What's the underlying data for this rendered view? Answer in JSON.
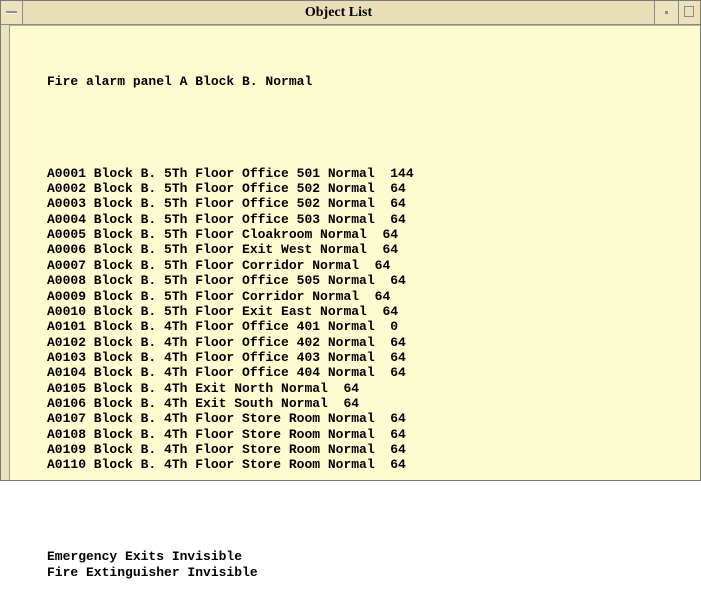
{
  "window": {
    "title": "Object List"
  },
  "content": {
    "header_line": "Fire alarm panel A Block B. Normal",
    "objects": [
      "A0001 Block B. 5Th Floor Office 501 Normal  144",
      "A0002 Block B. 5Th Floor Office 502 Normal  64",
      "A0003 Block B. 5Th Floor Office 502 Normal  64",
      "A0004 Block B. 5Th Floor Office 503 Normal  64",
      "A0005 Block B. 5Th Floor Cloakroom Normal  64",
      "A0006 Block B. 5Th Floor Exit West Normal  64",
      "A0007 Block B. 5Th Floor Corridor Normal  64",
      "A0008 Block B. 5Th Floor Office 505 Normal  64",
      "A0009 Block B. 5Th Floor Corridor Normal  64",
      "A0010 Block B. 5Th Floor Exit East Normal  64",
      "A0101 Block B. 4Th Floor Office 401 Normal  0",
      "A0102 Block B. 4Th Floor Office 402 Normal  64",
      "A0103 Block B. 4Th Floor Office 403 Normal  64",
      "A0104 Block B. 4Th Floor Office 404 Normal  64",
      "A0105 Block B. 4Th Exit North Normal  64",
      "A0106 Block B. 4Th Exit South Normal  64",
      "A0107 Block B. 4Th Floor Store Room Normal  64",
      "A0108 Block B. 4Th Floor Store Room Normal  64",
      "A0109 Block B. 4Th Floor Store Room Normal  64",
      "A0110 Block B. 4Th Floor Store Room Normal  64"
    ],
    "footer_lines": [
      "Emergency Exits Invisible",
      "Fire Extinguisher Invisible"
    ]
  },
  "colors": {
    "content_background": "#fdfbd0",
    "titlebar_background": "#e8dfb8",
    "text": "#000000"
  },
  "icons": {
    "window_menu": "window-menu-icon",
    "minimize": "minimize-icon",
    "maximize": "maximize-icon"
  }
}
